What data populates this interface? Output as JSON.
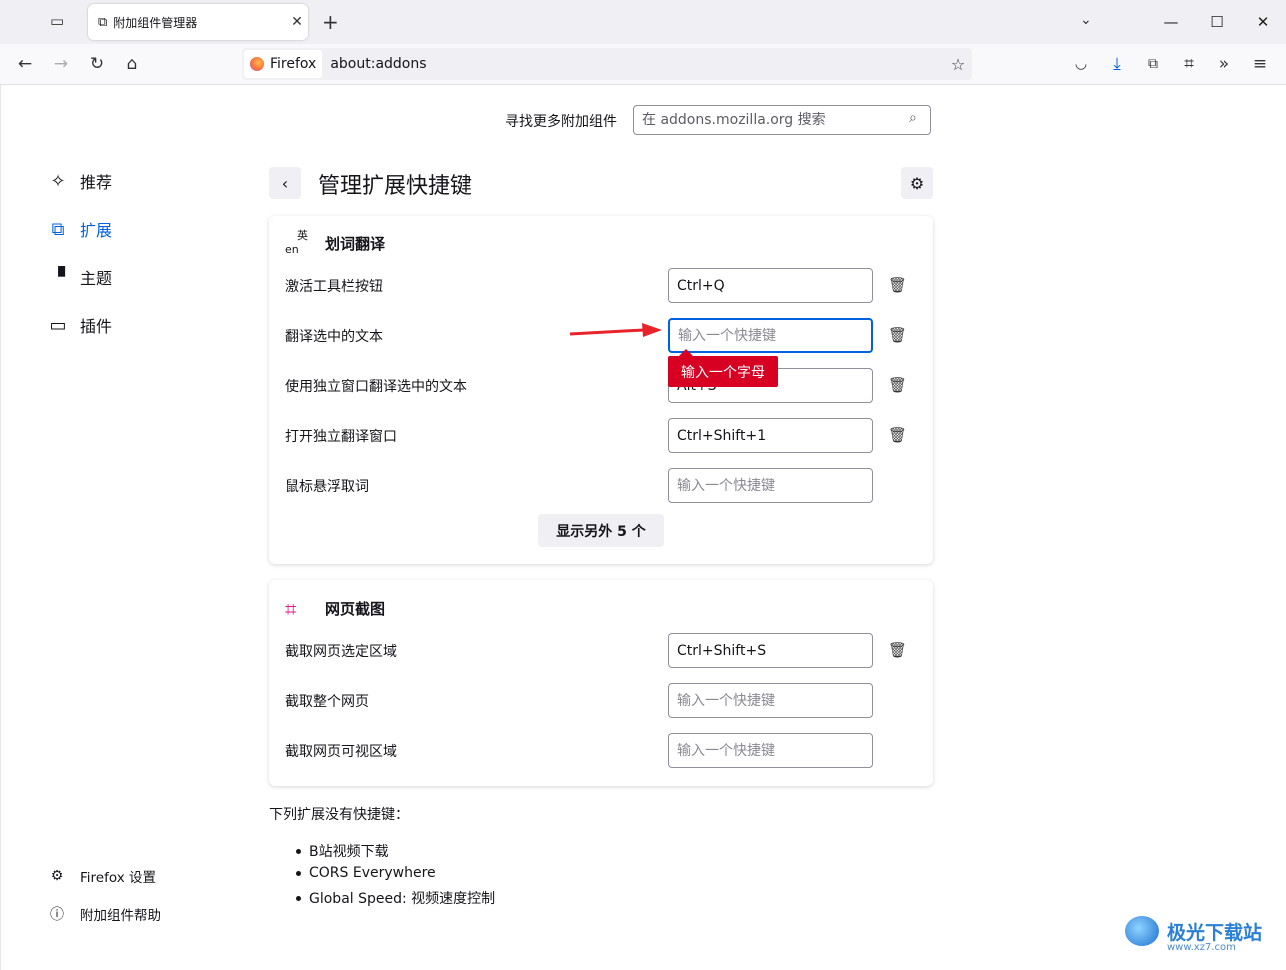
{
  "browser": {
    "tab_title": "附加组件管理器",
    "identity_label": "Firefox",
    "url": "about:addons"
  },
  "search": {
    "label": "寻找更多附加组件",
    "placeholder": "在 addons.mozilla.org 搜索"
  },
  "sidebar": {
    "items": [
      {
        "label": "推荐",
        "icon": "sparkle-icon"
      },
      {
        "label": "扩展",
        "icon": "puzzle-icon"
      },
      {
        "label": "主题",
        "icon": "brush-icon"
      },
      {
        "label": "插件",
        "icon": "plugin-icon"
      }
    ],
    "footer": [
      {
        "label": "Firefox 设置",
        "icon": "gear-icon"
      },
      {
        "label": "附加组件帮助",
        "icon": "help-icon"
      }
    ]
  },
  "page": {
    "title": "管理扩展快捷键"
  },
  "cards": [
    {
      "name": "划词翻译",
      "shortcuts": [
        {
          "label": "激活工具栏按钮",
          "value": "Ctrl+Q"
        },
        {
          "label": "翻译选中的文本",
          "value": ""
        },
        {
          "label": "使用独立窗口翻译选中的文本",
          "value": "Alt+S"
        },
        {
          "label": "打开独立翻译窗口",
          "value": "Ctrl+Shift+1"
        },
        {
          "label": "鼠标悬浮取词",
          "value": ""
        }
      ],
      "show_more": "显示另外 5 个"
    },
    {
      "name": "网页截图",
      "shortcuts": [
        {
          "label": "截取网页选定区域",
          "value": "Ctrl+Shift+S"
        },
        {
          "label": "截取整个网页",
          "value": ""
        },
        {
          "label": "截取网页可视区域",
          "value": ""
        }
      ]
    }
  ],
  "shortcut_placeholder": "输入一个快捷键",
  "error_tooltip": "输入一个字母",
  "no_shortcuts": {
    "heading": "下列扩展没有快捷键：",
    "items": [
      "B站视频下载",
      "CORS Everywhere",
      "Global Speed: 视频速度控制"
    ]
  },
  "watermark": {
    "text": "极光下载站",
    "sub": "www.xz7.com"
  },
  "colors": {
    "accent": "#0061e0",
    "error": "#d70022",
    "arrow": "#e8242a",
    "screenshot_icon": "#e31587"
  }
}
